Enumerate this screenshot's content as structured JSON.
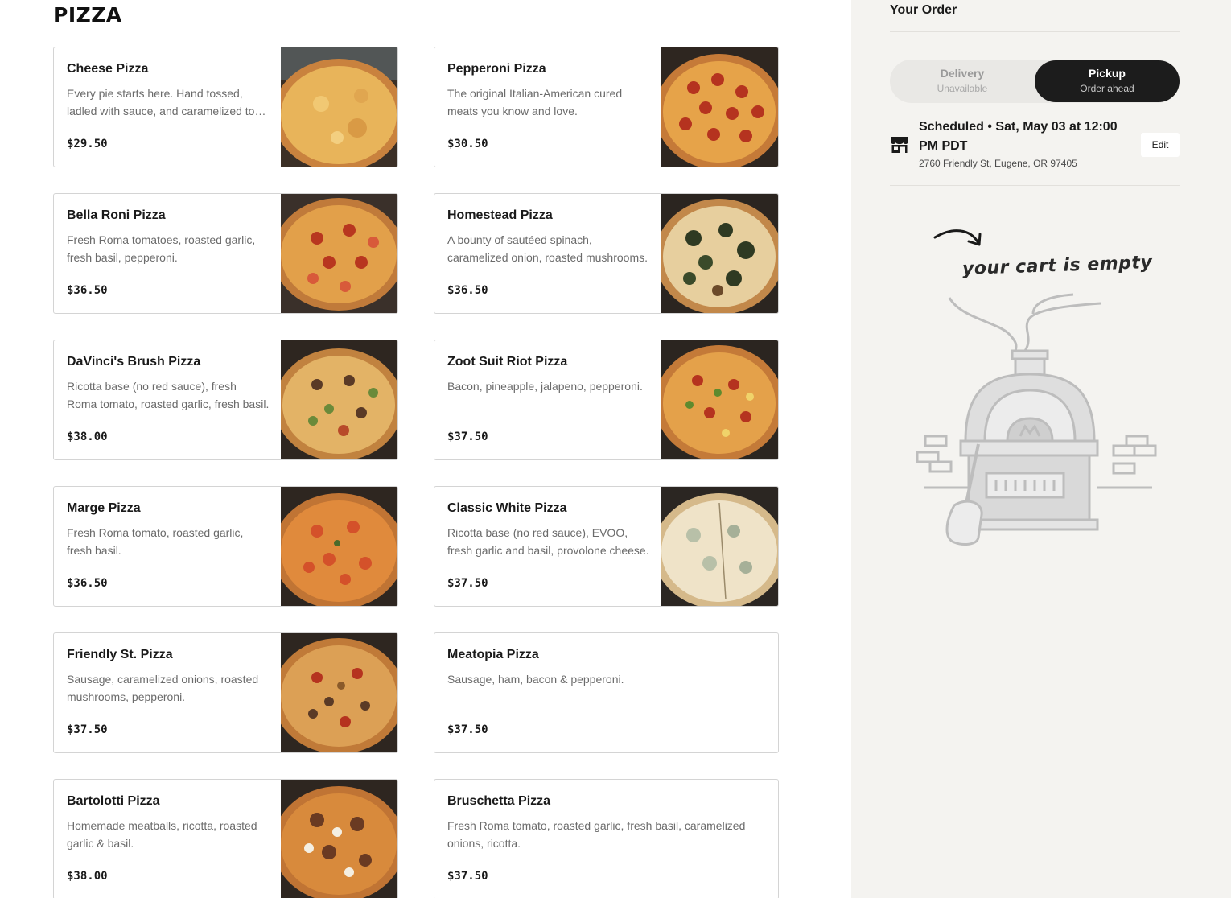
{
  "menu": {
    "section_title": "PIZZA",
    "items": [
      {
        "name": "Cheese Pizza",
        "description": "Every pie starts here. Hand tossed, ladled with sauce, and caramelized to perfection.",
        "price": "$29.50"
      },
      {
        "name": "Pepperoni Pizza",
        "description": "The original Italian-American cured meats you know and love.",
        "price": "$30.50"
      },
      {
        "name": "Bella Roni Pizza",
        "description": "Fresh Roma tomatoes, roasted garlic, fresh basil, pepperoni.",
        "price": "$36.50"
      },
      {
        "name": "Homestead Pizza",
        "description": "A bounty of sautéed spinach, caramelized onion, roasted mushrooms.",
        "price": "$36.50"
      },
      {
        "name": "DaVinci's Brush Pizza",
        "description": "Ricotta base (no red sauce), fresh Roma tomato, roasted garlic, fresh basil.",
        "price": "$38.00"
      },
      {
        "name": "Zoot Suit Riot Pizza",
        "description": "Bacon, pineapple, jalapeno, pepperoni.",
        "price": "$37.50"
      },
      {
        "name": "Marge Pizza",
        "description": "Fresh Roma tomato, roasted garlic, fresh basil.",
        "price": "$36.50"
      },
      {
        "name": "Classic White Pizza",
        "description": "Ricotta base (no red sauce), EVOO, fresh garlic and basil, provolone cheese.",
        "price": "$37.50"
      },
      {
        "name": "Friendly St. Pizza",
        "description": "Sausage, caramelized onions, roasted mushrooms, pepperoni.",
        "price": "$37.50"
      },
      {
        "name": "Meatopia Pizza",
        "description": "Sausage, ham, bacon & pepperoni.",
        "price": "$37.50"
      },
      {
        "name": "Bartolotti Pizza",
        "description": "Homemade meatballs, ricotta, roasted garlic & basil.",
        "price": "$38.00"
      },
      {
        "name": "Bruschetta Pizza",
        "description": "Fresh Roma tomato, roasted garlic, fresh basil, caramelized onions, ricotta.",
        "price": "$37.50"
      }
    ]
  },
  "order": {
    "title": "Your Order",
    "delivery_label": "Delivery",
    "delivery_sub": "Unavailable",
    "pickup_label": "Pickup",
    "pickup_sub": "Order ahead",
    "scheduled": "Scheduled • Sat, May 03 at 12:00 PM PDT",
    "address": "2760 Friendly St, Eugene, OR 97405",
    "edit_label": "Edit",
    "empty_text": "your cart is empty",
    "icons": {
      "store": "storefront-icon",
      "arrow": "curved-arrow-icon",
      "illustration": "pizza-oven-illustration"
    }
  },
  "colors": {
    "sidebar_bg": "#f4f3f0",
    "toggle_active": "#1c1c1c",
    "card_border": "#d4d4d4",
    "muted_text": "#6b6b6b"
  }
}
